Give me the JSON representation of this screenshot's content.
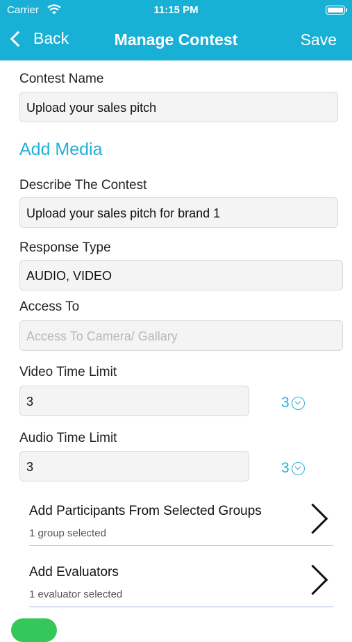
{
  "status_bar": {
    "carrier": "Carrier",
    "time": "11:15 PM"
  },
  "nav": {
    "back_label": "Back",
    "title": "Manage Contest",
    "save_label": "Save"
  },
  "contest_name": {
    "label": "Contest Name",
    "value": "Upload your sales pitch"
  },
  "add_media": {
    "label": "Add Media"
  },
  "describe": {
    "label": "Describe The Contest",
    "value": "Upload your sales pitch for brand 1"
  },
  "response_type": {
    "label": "Response Type",
    "value": "AUDIO, VIDEO"
  },
  "access_to": {
    "label": "Access To",
    "placeholder": "Access To Camera/ Gallary"
  },
  "video_limit": {
    "label": "Video Time Limit",
    "value": "3",
    "selected": "3"
  },
  "audio_limit": {
    "label": "Audio Time Limit",
    "value": "3",
    "selected": "3"
  },
  "participants": {
    "title": "Add Participants From Selected Groups",
    "subtitle": "1 group selected"
  },
  "evaluators": {
    "title": "Add Evaluators",
    "subtitle": "1 evaluator selected"
  },
  "colors": {
    "accent": "#19b0d6",
    "toggle_on": "#34c759"
  },
  "toggle": {
    "on": true
  }
}
